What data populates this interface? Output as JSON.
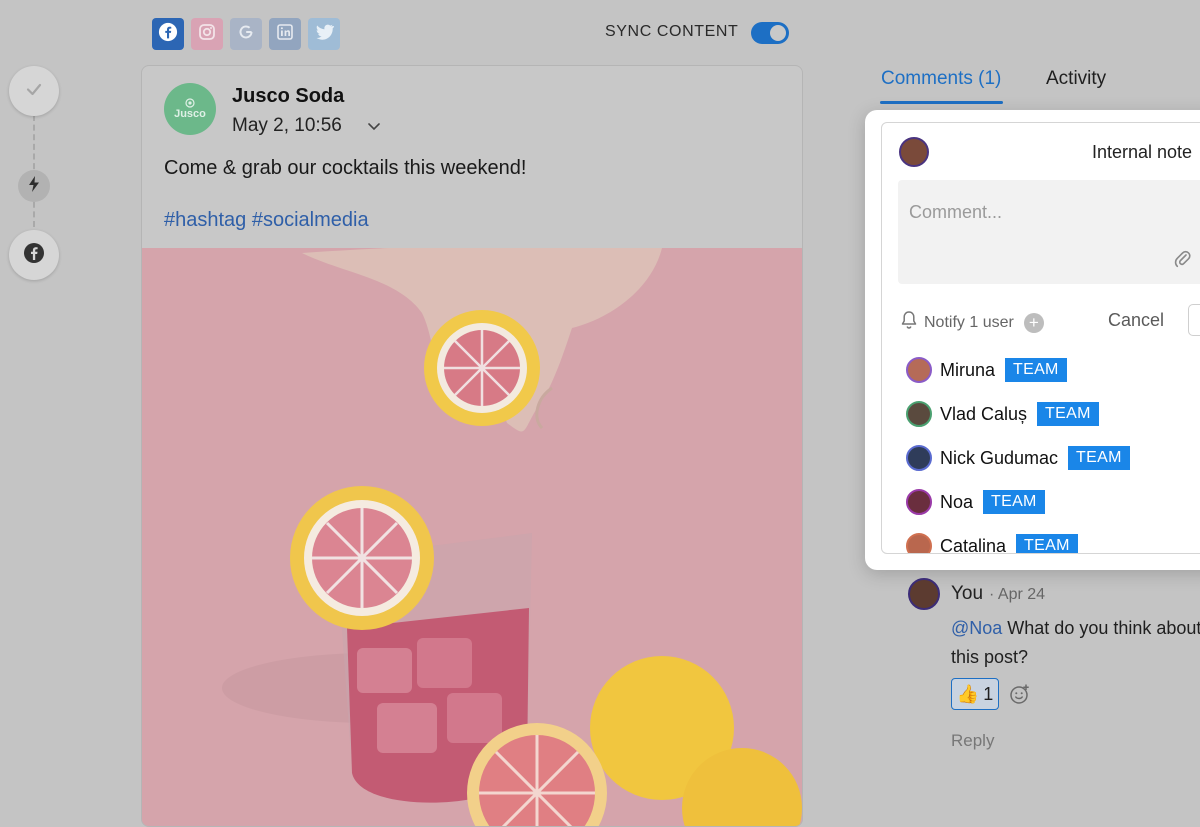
{
  "toolbar": {
    "sync_label": "SYNC CONTENT",
    "sync_enabled": true,
    "social_icons": [
      "facebook-icon",
      "instagram-icon",
      "google-icon",
      "linkedin-icon",
      "twitter-icon"
    ]
  },
  "rail": {
    "icons": [
      "check-icon",
      "lightning-icon",
      "facebook-icon"
    ]
  },
  "post": {
    "brand_name": "Jusco Soda",
    "avatar_text": "Jusco",
    "date": "May 2, 10:56",
    "text": "Come & grab our cocktails this weekend!",
    "hashtags": "#hashtag #socialmedia"
  },
  "tabs": {
    "comments": "Comments (1)",
    "activity": "Activity"
  },
  "comment_form": {
    "internal_note": "Internal note",
    "placeholder": "Comment...",
    "notify": "Notify 1 user",
    "cancel": "Cancel"
  },
  "mentions": [
    {
      "name": "Miruna",
      "badge": "TEAM"
    },
    {
      "name": "Vlad Caluș",
      "badge": "TEAM"
    },
    {
      "name": "Nick Gudumac",
      "badge": "TEAM"
    },
    {
      "name": "Noa",
      "badge": "TEAM"
    },
    {
      "name": "Catalina",
      "badge": "TEAM"
    }
  ],
  "comment": {
    "author": "You",
    "date": "· Apr 24",
    "mention": "@Noa",
    "text": " What do you think about this post?",
    "reaction_emoji": "👍",
    "reaction_count": "1",
    "reply": "Reply"
  },
  "colors": {
    "accent": "#1d6fc4",
    "team_badge": "#1a86e8",
    "brand_green": "#6cb88a"
  }
}
